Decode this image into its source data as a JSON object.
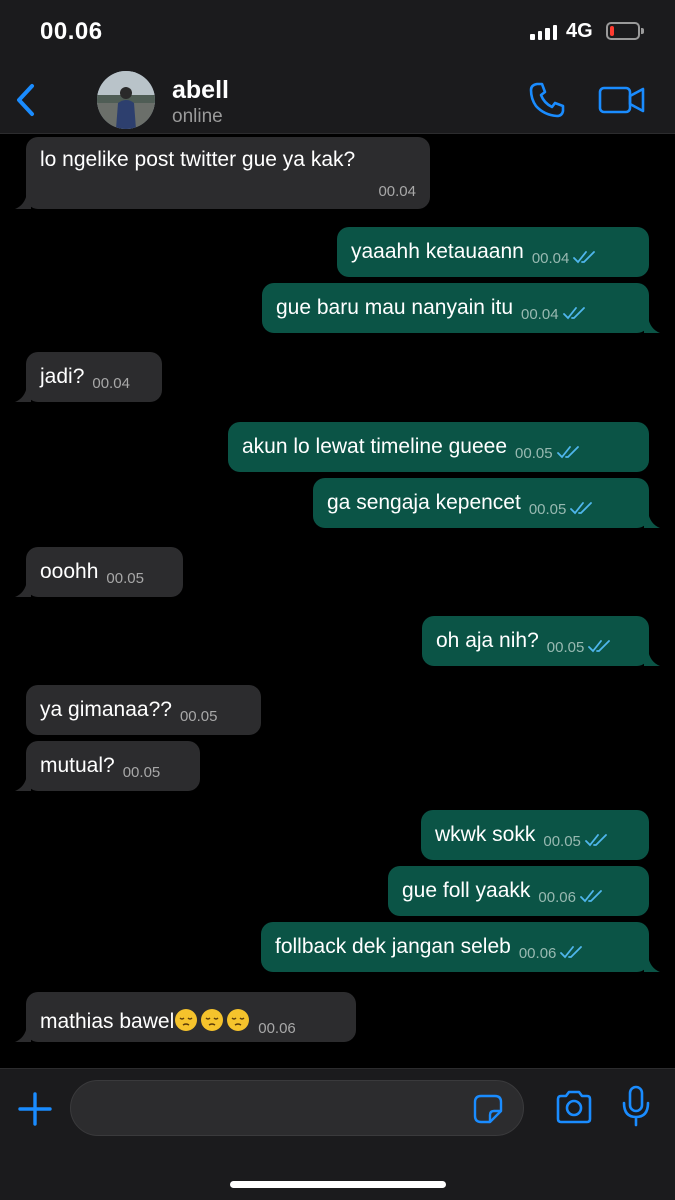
{
  "status_bar": {
    "time": "00.06",
    "network": "4G",
    "battery_percent": 15
  },
  "header": {
    "contact_name": "abell",
    "contact_status": "online"
  },
  "colors": {
    "accent": "#1a8cff",
    "incoming_bubble": "#2c2c2e",
    "outgoing_bubble": "#0b5446",
    "read_ticks": "#4fb6ec"
  },
  "messages": [
    {
      "direction": "in",
      "text": "lo ngelike post twitter gue ya kak?",
      "time": "00.04"
    },
    {
      "direction": "out",
      "text": "yaaahh ketauaann",
      "time": "00.04"
    },
    {
      "direction": "out",
      "text": "gue baru mau nanyain itu",
      "time": "00.04"
    },
    {
      "direction": "in",
      "text": "jadi?",
      "time": "00.04"
    },
    {
      "direction": "out",
      "text": "akun lo lewat timeline gueee",
      "time": "00.05"
    },
    {
      "direction": "out",
      "text": "ga sengaja kepencet",
      "time": "00.05"
    },
    {
      "direction": "in",
      "text": "ooohh",
      "time": "00.05"
    },
    {
      "direction": "out",
      "text": "oh aja nih?",
      "time": "00.05"
    },
    {
      "direction": "in",
      "text": "ya gimanaa??",
      "time": "00.05"
    },
    {
      "direction": "in",
      "text": "mutual?",
      "time": "00.05"
    },
    {
      "direction": "out",
      "text": "wkwk sokk",
      "time": "00.05"
    },
    {
      "direction": "out",
      "text": "gue foll yaakk",
      "time": "00.06"
    },
    {
      "direction": "out",
      "text": "follback dek jangan seleb",
      "time": "00.06"
    },
    {
      "direction": "in",
      "text": "mathias bawel",
      "emoji": "😔😔😔",
      "time": "00.06"
    }
  ],
  "input": {
    "placeholder": ""
  },
  "icons": [
    "back-icon",
    "call-icon",
    "video-icon",
    "plus-icon",
    "sticker-icon",
    "camera-icon",
    "mic-icon",
    "read-ticks-icon",
    "pensive-face-emoji"
  ]
}
